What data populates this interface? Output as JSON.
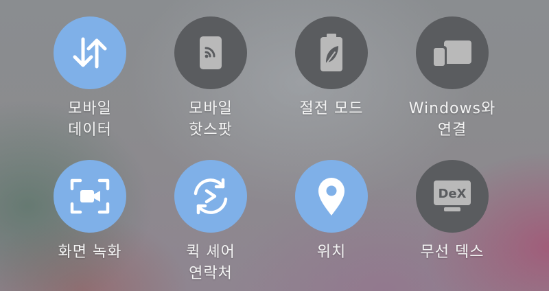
{
  "quick_panel": {
    "tiles": [
      {
        "icon": "data-transfer-arrows-icon",
        "state": "on",
        "line1": "모바일",
        "line2": "데이터"
      },
      {
        "icon": "mobile-hotspot-icon",
        "state": "off",
        "line1": "모바일",
        "line2": "핫스팟"
      },
      {
        "icon": "battery-leaf-icon",
        "state": "off",
        "line1": "절전 모드",
        "line2": ""
      },
      {
        "icon": "link-to-windows-icon",
        "state": "off",
        "line1": "Windows와",
        "line2": "연결"
      },
      {
        "icon": "screen-recorder-icon",
        "state": "on",
        "line1": "화면 녹화",
        "line2": ""
      },
      {
        "icon": "quick-share-icon",
        "state": "on",
        "line1": "퀵 셰어",
        "line2": "연락처"
      },
      {
        "icon": "location-pin-icon",
        "state": "on",
        "line1": "위치",
        "line2": ""
      },
      {
        "icon": "dex-icon",
        "state": "off",
        "line1": "무선 덱스",
        "line2": "",
        "badge": "DeX"
      }
    ]
  },
  "colors": {
    "active": "#7fb0e8",
    "inactive": "#5a5c5f",
    "label": "#f4f4f4"
  }
}
